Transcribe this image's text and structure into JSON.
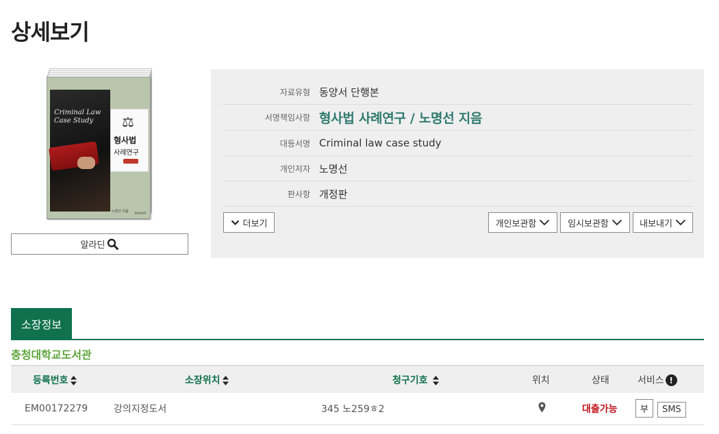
{
  "page": {
    "title": "상세보기"
  },
  "cover": {
    "title_en": "Criminal Law\nCase Study",
    "title_ko": "형사법",
    "subtitle_ko": "사례연구",
    "author": "노명선 지음",
    "publisher": "BOOKUP"
  },
  "aladin_button": {
    "label": "알라딘"
  },
  "info": {
    "rows": [
      {
        "label": "자료유형",
        "value": "동양서 단행본"
      },
      {
        "label": "서명책임사항",
        "value": "형사법 사례연구 / 노명선 지음"
      },
      {
        "label": "대등서명",
        "value": "Criminal law case study"
      },
      {
        "label": "개인저자",
        "value": "노명선"
      },
      {
        "label": "판사항",
        "value": "개정판"
      }
    ],
    "more_label": "더보기",
    "actions": [
      "개인보관함",
      "임시보관함",
      "내보내기"
    ]
  },
  "holdings": {
    "tab_label": "소장정보",
    "library": "충청대학교도서관",
    "columns": [
      "등록번호",
      "소장위치",
      "청구기호",
      "위치",
      "상태",
      "서비스"
    ],
    "rows": [
      {
        "reg_no": "EM00172279",
        "location": "강의지정도서",
        "call_no": "345 노259ㅎ2",
        "status": "대출가능",
        "services": [
          "부",
          "SMS"
        ]
      }
    ]
  },
  "colors": {
    "brand": "#10714f",
    "title_link": "#2f7a6f",
    "library_name": "#5da53a",
    "status_available": "#c0141e",
    "panel_bg": "#efefef"
  },
  "icons": [
    "search-icon",
    "chevron-down-icon",
    "sort-icon",
    "map-pin-icon",
    "info-icon"
  ]
}
